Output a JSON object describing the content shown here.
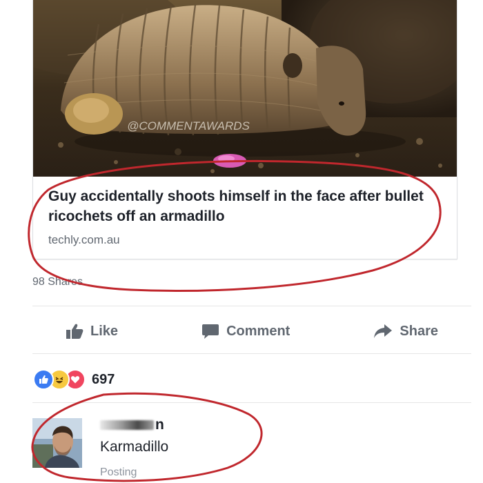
{
  "post": {
    "image_watermark": "@COMMENTAWARDS",
    "headline": "Guy accidentally shoots himself in the face after bullet ricochets off an armadillo",
    "domain": "techly.com.au",
    "shares": "98 Shares"
  },
  "actions": {
    "like": "Like",
    "comment": "Comment",
    "share": "Share"
  },
  "reactions": {
    "types": [
      "like",
      "haha",
      "love"
    ],
    "count": "697"
  },
  "comment": {
    "author_visible": "n",
    "text": "Karmadillo",
    "status": "Posting"
  },
  "colors": {
    "annotation": "#c0272d",
    "reaction_like": "#3b7bf2",
    "reaction_haha": "#f7c940",
    "reaction_love": "#f0455f"
  }
}
